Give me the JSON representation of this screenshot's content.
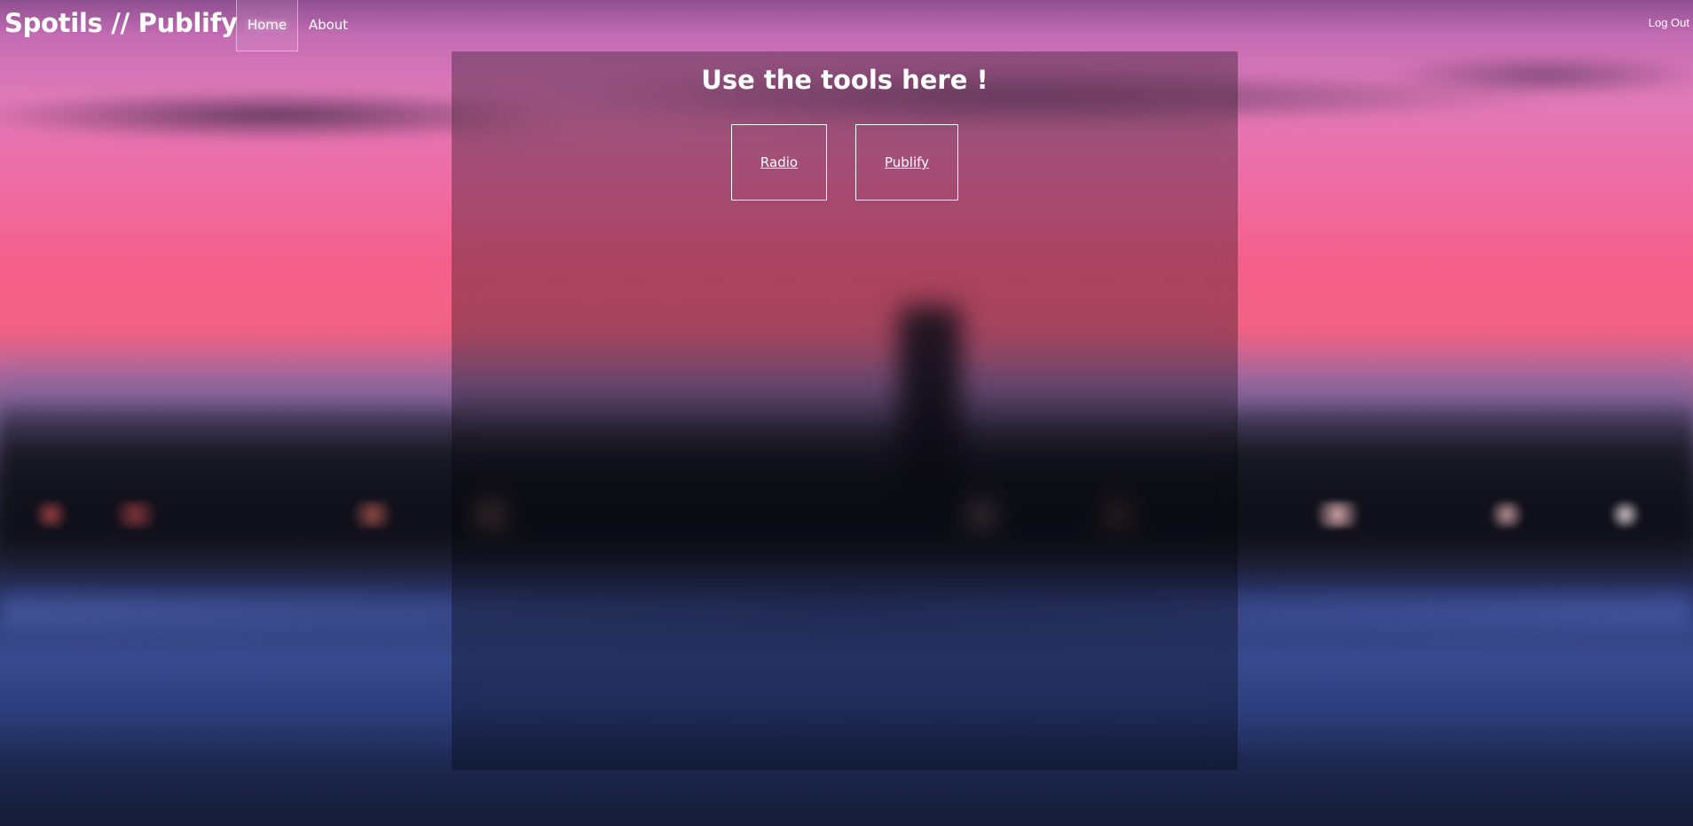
{
  "navbar": {
    "brand": "Spotils // Publify",
    "links": [
      {
        "label": "Home",
        "active": true
      },
      {
        "label": "About",
        "active": false
      }
    ],
    "logout_label": "Log Out"
  },
  "main": {
    "title": "Use the tools here !",
    "tools": [
      {
        "label": "Radio"
      },
      {
        "label": "Publify"
      }
    ]
  },
  "colors": {
    "text": "#ffffff",
    "panel_overlay": "rgba(0,0,0,0.30)"
  }
}
